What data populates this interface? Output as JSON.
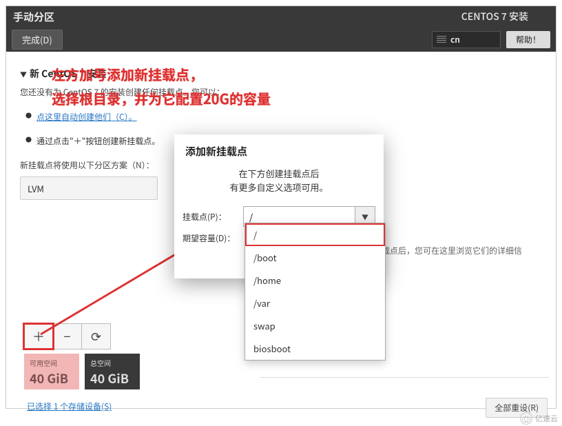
{
  "header": {
    "title": "手动分区",
    "installer_title": "CENTOS 7 安装",
    "done_btn": "完成(D)",
    "lang_code": "cn",
    "help_btn": "帮助！"
  },
  "left": {
    "section_title": "新 CentOS 7 安装",
    "desc": "您还没有为 CentOS 7 的安装创建任何挂载点。您可以：",
    "bullets": {
      "auto_link": "点这里自动创建他们（C）。",
      "manual": "通过点击\"＋\"按钮创建新挂载点。"
    },
    "scheme_label": "新挂载点将使用以下分区方案（N）：",
    "scheme_value": "LVM"
  },
  "toolbar": {
    "add": "＋",
    "remove": "−",
    "reload": "⟳"
  },
  "space": {
    "avail_label": "可用空间",
    "avail_value": "40 GiB",
    "total_label": "总空间",
    "total_value": "40 GiB"
  },
  "storage_link": "已选择 1 个存储设备(S)",
  "reset_btn": "全部重设(R)",
  "right_hint": "载点后，您可在这里浏览它们的详细信",
  "dialog": {
    "title": "添加新挂载点",
    "sub1": "在下方创建挂载点后",
    "sub2": "有更多自定义选项可用。",
    "mount_label": "挂载点(P)：",
    "mount_value": "/",
    "cap_label": "期望容量(D)："
  },
  "dropdown": {
    "items": [
      "/",
      "/boot",
      "/home",
      "/var",
      "swap",
      "biosboot"
    ],
    "selected_index": 0
  },
  "overlay": {
    "line1": "左方加号添加新挂载点，",
    "line2": "选择根目录，并为它配置20G的容量"
  },
  "watermark": "亿速云"
}
